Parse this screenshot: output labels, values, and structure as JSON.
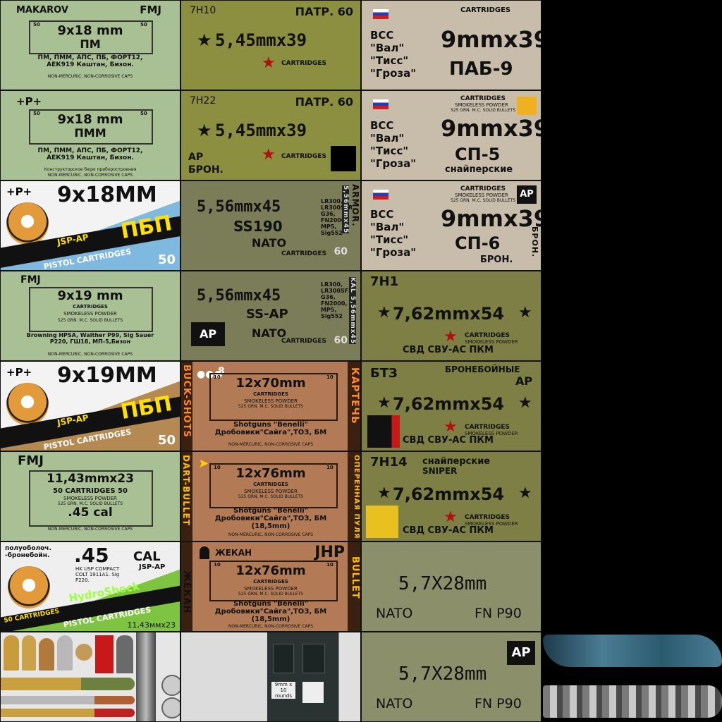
{
  "tiles": {
    "makarov": {
      "top": "MAKAROV",
      "fmj": "FMJ",
      "cal": "9x18 mm",
      "name": "ПМ",
      "n50a": "50",
      "n50b": "50",
      "guns": "ПМ, ПММ, АПС, ПБ, ФОРТ12, АЕК919 Каштан, Бизон.",
      "caps": "NON-MERCURIC, NON-CORROSIVE CAPS"
    },
    "pmm": {
      "top": "+P+",
      "cal": "9x18 mm",
      "name": "ПММ",
      "n50a": "50",
      "n50b": "50",
      "guns": "ПМ, ПММ, АПС, ПБ, ФОРТ12, АЕК919 Каштан, Бизон.",
      "note": "Конструкторское бюро приборостроения",
      "caps": "NON-MERCURIC, NON-CORROSIVE CAPS"
    },
    "pbp918": {
      "top": "+P+",
      "cal": "9x18MM",
      "brand": "ПБП",
      "sub": "JSP-AP",
      "band": "PISTOL CARTRIDGES",
      "count": "50"
    },
    "fmj919": {
      "top": "FMJ",
      "cal": "9x19 mm",
      "line1": "CARTRIDGES",
      "line2": "SMOKELESS POWDER",
      "line3": "525 GRN. M.C. SOLID BULLETS",
      "guns": "Browning HPSA, Walther P99, Sig Sauer P220, ГШ18, МП-5,Бизон",
      "caps": "NON-MERCURIC, NON-CORROSIVE CAPS"
    },
    "pbp919": {
      "top": "+P+",
      "cal": "9x19MM",
      "brand": "ПБП",
      "sub": "JSP-AP",
      "band": "PISTOL CARTRIDGES",
      "count": "50"
    },
    "fmj45": {
      "top": "FMJ",
      "cal": "11,43mmx23",
      "line1": "50 CARTRIDGES 50",
      "line2": "SMOKELESS POWDER",
      "line3": "525 GRN. M.C. SOLID BULLETS",
      "cal2": ".45 cal",
      "caps": "NON-MERCURIC, NON-CORROSIVE CAPS"
    },
    "hydro": {
      "ru": "полуоболоч. -бронебойн.",
      "cal": ".45",
      "calw": "CAL",
      "sub": "JSP-AP",
      "guns": "HK USP COMPACT COLT 1911A1. Sig P220.",
      "brand": "HydroShock",
      "count": "50 CARTRIDGES",
      "band": "PISTOL CARTRIDGES",
      "cal2": "11,43ммx23"
    },
    "c7n10": {
      "code": "7Н10",
      "patr": "ПАТР. 60",
      "cal": "5,45mmx39",
      "label": "CARTRIDGES"
    },
    "c7n22": {
      "code": "7Н22",
      "patr": "ПАТР. 60",
      "cal": "5,45mmx39",
      "label": "CARTRIDGES",
      "ap": "AP",
      "bron": "БРОН."
    },
    "ss190": {
      "cal": "5,56mmx45",
      "name": "SS190",
      "nato": "NATO",
      "guns": "LR300, LR300SFR, G36, FN2000, MP5, Sig552",
      "label": "CARTRIDGES",
      "count": "60",
      "side": "ARMOR.",
      "kal": "5,56mmx45"
    },
    "ssap": {
      "cal": "5,56mmx45",
      "name": "SS-AP",
      "nato": "NATO",
      "guns": "LR300, LR300SFR, G36, FN2000, MP5, Sig552",
      "label": "CARTRIDGES",
      "count": "60",
      "ap": "AP",
      "kal": "KAL 5,56mmx45"
    },
    "buck": {
      "side": "BUCK-SHOTS",
      "count": "8",
      "cal": "12x70mm",
      "line1": "CARTRIDGES",
      "line2": "SMOKELESS POWDER",
      "line3": "525 GRN. M.C. SOLID BULLETS",
      "guns": "Shotguns \"Benelli\" Дробовики\"Сайга\",ТОЗ, БМ",
      "caps": "NON-MERCURIC, NON-CORROSIVE CAPS",
      "sideR": "КАРТЕЧЬ",
      "n10a": "10",
      "n10b": "10"
    },
    "dart": {
      "side": "DART-BULLET",
      "cal": "12x76mm",
      "line1": "CARTRIDGES",
      "line2": "SMOKELESS POWDER",
      "line3": "525 GRN. M.C. SOLID BULLETS",
      "guns": "Shotguns \"Benelli\" Дробовики\"Сайга\",ТОЗ, БМ (18,5mm)",
      "caps": "NON-MERCURIC, NON-CORROSIVE CAPS",
      "sideR": "ОПЕРЕННАЯ ПУЛЯ",
      "n10a": "10",
      "n10b": "10"
    },
    "jhp": {
      "top": "ЖЕКАН",
      "jhp": "JHP",
      "cal": "12x76mm",
      "line1": "CARTRIDGES",
      "line2": "SMOKELESS POWDER",
      "line3": "525 GRN. M.C. SOLID BULLETS",
      "guns": "Shotguns \"Benelli\" Дробовики\"Сайга\",ТОЗ, БМ (18,5mm)",
      "caps": "NON-MERCURIC, NON-CORROSIVE CAPS",
      "side": "ЖЕКАН",
      "sideR": "BULLET",
      "n10a": "10",
      "n10b": "10"
    },
    "pab9": {
      "hdr": "CARTRIDGES",
      "v1": "ВСС",
      "v2": "\"Вал\"",
      "v3": "\"Тисс\"",
      "v4": "\"Гроза\"",
      "cal": "9mmx39",
      "name": "ПАБ-9"
    },
    "sp5": {
      "hdr": "CARTRIDGES",
      "hdr2": "SMOKELESS POWDER",
      "hdr3": "525 GRN. M.C. SOLID BULLETS",
      "v1": "ВСС",
      "v2": "\"Вал\"",
      "v3": "\"Тисс\"",
      "v4": "\"Гроза\"",
      "cal": "9mmx39",
      "name": "СП-5",
      "sub": "снайперские"
    },
    "sp6": {
      "hdr": "CARTRIDGES",
      "hdr2": "SMOKELESS POWDER",
      "hdr3": "525 GRN. M.C. SOLID BULLETS",
      "v1": "ВСС",
      "v2": "\"Вал\"",
      "v3": "\"Тисс\"",
      "v4": "\"Гроза\"",
      "cal": "9mmx39",
      "name": "СП-6",
      "sub": "БРОН.",
      "ap": "AP",
      "side": "БРОН."
    },
    "c7n1": {
      "code": "7Н1",
      "cal": "7,62mmx54",
      "label": "CARTRIDGES",
      "line2": "SMOKELESS POWDER",
      "guns": "СВД СВУ-АС ПКМ"
    },
    "bt3": {
      "code": "БТЗ",
      "ru": "БРОНЕБОЙНЫЕ",
      "ap": "AP",
      "cal": "7,62mmx54",
      "label": "CARTRIDGES",
      "line2": "SMOKELESS POWDER",
      "guns": "СВД СВУ-АС ПКМ"
    },
    "c7n14": {
      "code": "7Н14",
      "ru": "снайперские",
      "sniper": "SNIPER",
      "cal": "7,62mmx54",
      "label": "CARTRIDGES",
      "line2": "SMOKELESS POWDER",
      "guns": "СВД СВУ-АС ПКМ"
    },
    "p90": {
      "cal": "5,7X28mm",
      "nato": "NATO",
      "gun": "FN P90"
    },
    "p90ap": {
      "cal": "5,7X28mm",
      "nato": "NATO",
      "gun": "FN P90",
      "ap": "AP"
    },
    "panel": {
      "tag": "9mm x 10 rounds"
    }
  }
}
